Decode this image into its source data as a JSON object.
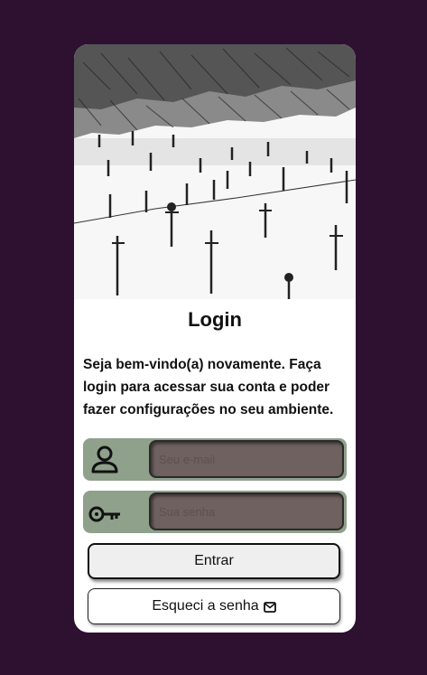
{
  "card": {
    "title": "Login",
    "intro": "Seja bem-vindo(a) novamente. Faça login para acessar sua conta e poder fazer configurações no seu ambiente."
  },
  "form": {
    "email_placeholder": "Seu e-mail",
    "password_placeholder": "Sua senha",
    "email_icon": "user-icon",
    "password_icon": "key-icon"
  },
  "buttons": {
    "enter_label": "Entrar",
    "forgot_label": "Esqueci a senha",
    "forgot_icon": "mail-icon"
  },
  "colors": {
    "background": "#2e1130",
    "card": "#ffffff",
    "field_container": "#8fa08b",
    "input_fill": "#6e6160"
  }
}
